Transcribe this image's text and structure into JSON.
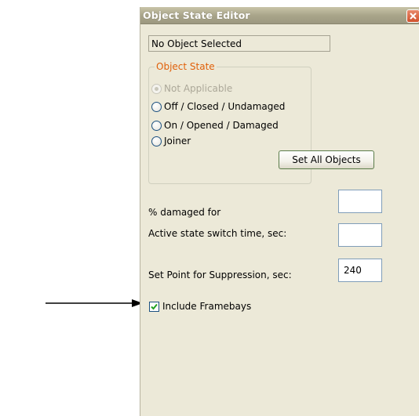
{
  "window": {
    "title": "Object State Editor",
    "close_icon": "close-x-icon"
  },
  "status_text": "No Object Selected",
  "object_state": {
    "group_label": "Object State",
    "options": [
      {
        "label": "Not Applicable",
        "disabled": true,
        "selected": true
      },
      {
        "label": "Off / Closed / Undamaged",
        "disabled": false,
        "selected": false
      },
      {
        "label": "On / Opened / Damaged",
        "disabled": false,
        "selected": false
      },
      {
        "label": "Joiner",
        "disabled": false,
        "selected": false
      }
    ],
    "set_all_label": "Set All Objects"
  },
  "fields": {
    "damaged_label": "% damaged for",
    "damaged_value": "",
    "switch_time_label": "Active state switch time, sec:",
    "switch_time_value": "",
    "suppression_label": "Set Point for Suppression, sec:",
    "suppression_value": "240"
  },
  "include_framebays": {
    "label": "Include Framebays",
    "checked": true
  },
  "colors": {
    "window_bg": "#ece9d8",
    "group_title": "#e0600a",
    "disabled_text": "#aca899",
    "close_button": "#d0502c"
  }
}
